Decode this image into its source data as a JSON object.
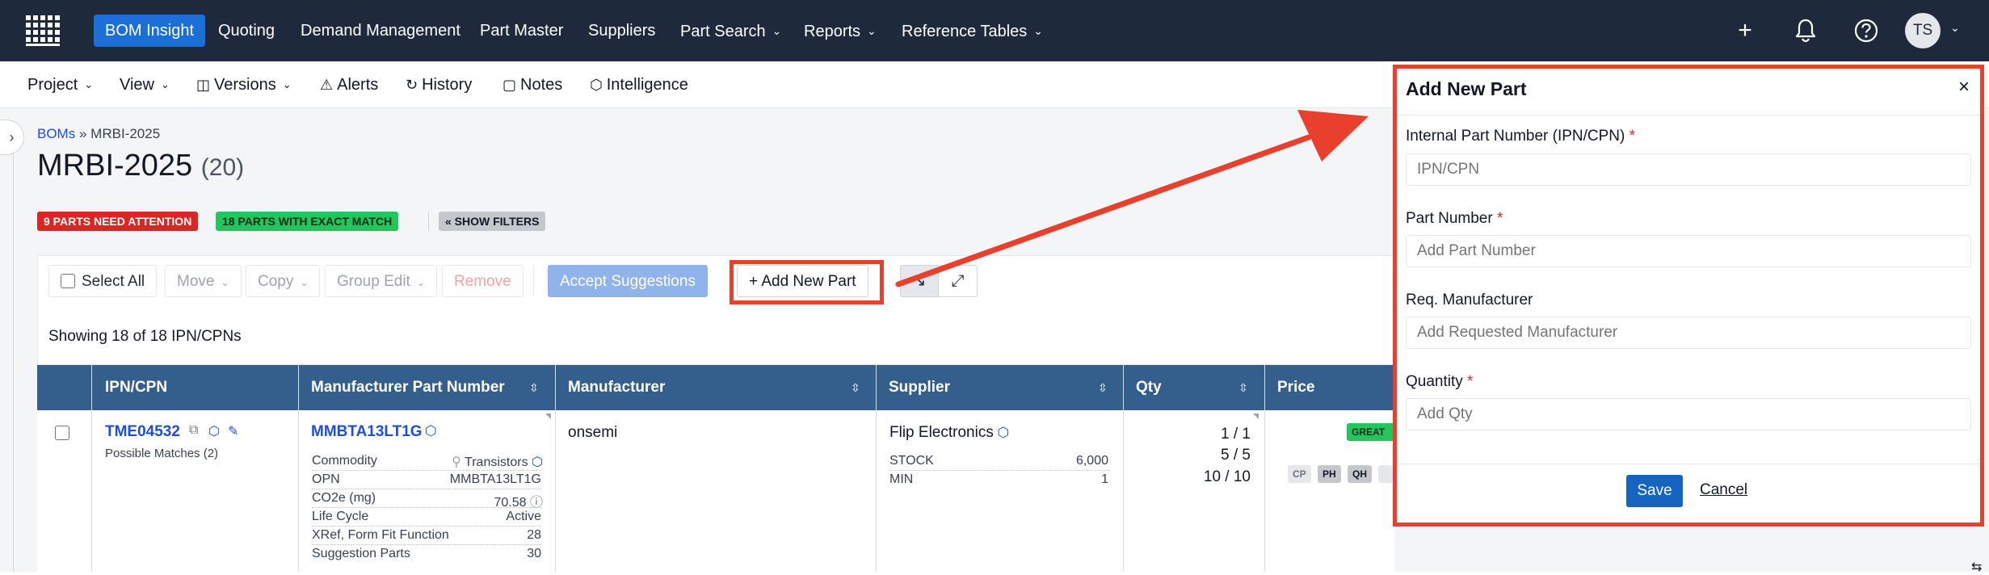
{
  "topnav": {
    "items": [
      "BOM Insight",
      "Quoting",
      "Demand Management",
      "Part Master",
      "Suppliers",
      "Part Search",
      "Reports",
      "Reference Tables"
    ],
    "avatar": "TS"
  },
  "subnav": {
    "items": [
      "Project",
      "View",
      "Versions",
      "Alerts",
      "History",
      "Notes",
      "Intelligence"
    ]
  },
  "breadcrumb": {
    "root": "BOMs",
    "sep": "»",
    "current": "MRBI-2025"
  },
  "page": {
    "title": "MRBI-2025",
    "count": "(20)"
  },
  "badges": {
    "attention": "9 PARTS NEED ATTENTION",
    "exact": "18 PARTS WITH EXACT MATCH",
    "filters": "« SHOW FILTERS"
  },
  "toolbar": {
    "select_all": "Select All",
    "move": "Move",
    "copy": "Copy",
    "group_edit": "Group Edit",
    "remove": "Remove",
    "accept": "Accept Suggestions",
    "add_new_part": "+ Add New Part"
  },
  "showing": "Showing 18 of 18 IPN/CPNs",
  "table": {
    "headers": [
      "IPN/CPN",
      "Manufacturer Part Number",
      "Manufacturer",
      "Supplier",
      "Qty",
      "Price"
    ],
    "row": {
      "ipn": "TME04532",
      "possible_matches": "Possible Matches (2)",
      "mpn": "MMBTA13LT1G",
      "details": [
        {
          "k": "Commodity",
          "v": "Transistors"
        },
        {
          "k": "OPN",
          "v": "MMBTA13LT1G"
        },
        {
          "k": "CO2e (mg)",
          "v": "70.58"
        },
        {
          "k": "Life Cycle",
          "v": "Active"
        },
        {
          "k": "XRef, Form Fit Function",
          "v": "28"
        },
        {
          "k": "Suggestion Parts",
          "v": "30"
        }
      ],
      "manufacturer": "onsemi",
      "supplier": "Flip Electronics",
      "supplier_details": [
        {
          "k": "STOCK",
          "v": "6,000"
        },
        {
          "k": "MIN",
          "v": "1"
        }
      ],
      "qty": [
        "1 / 1",
        "5 / 5",
        "10 / 10"
      ],
      "price_badge": "GREAT",
      "price_tags": [
        "CP",
        "PH",
        "QH"
      ]
    }
  },
  "panel": {
    "title": "Add New Part",
    "close": "×",
    "fields": [
      {
        "label": "Internal Part Number (IPN/CPN)",
        "required": "*",
        "placeholder": "IPN/CPN"
      },
      {
        "label": "Part Number",
        "required": "*",
        "placeholder": "Add Part Number"
      },
      {
        "label": "Req. Manufacturer",
        "required": "",
        "placeholder": "Add Requested Manufacturer"
      },
      {
        "label": "Quantity",
        "required": "*",
        "placeholder": "Add Qty"
      }
    ],
    "save": "Save",
    "cancel": "Cancel"
  },
  "colors": {
    "nav_bg": "#1e293b",
    "accent": "#1d6fd8",
    "highlight": "#e8402d",
    "table_header": "#345f8c"
  }
}
